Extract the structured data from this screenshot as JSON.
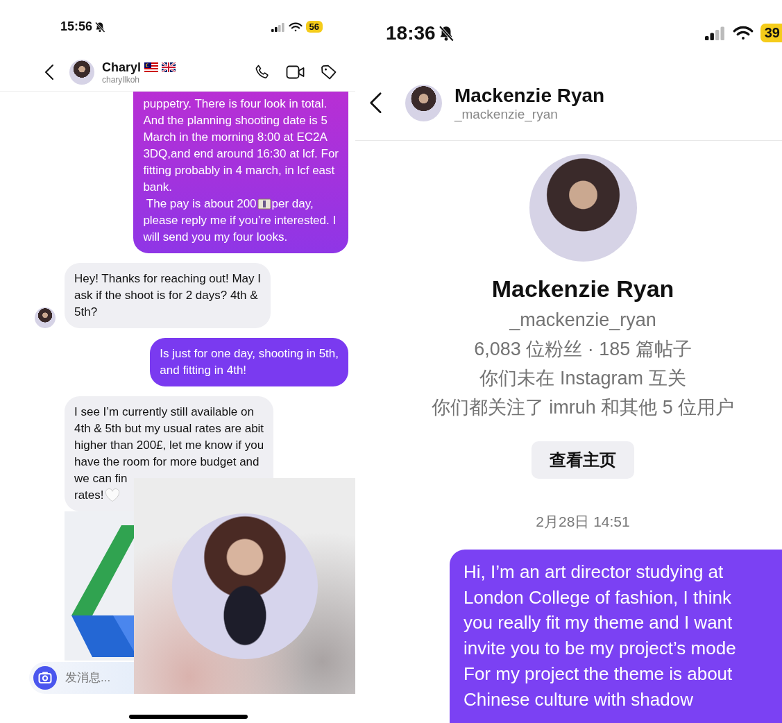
{
  "left_phone": {
    "status_bar": {
      "time": "15:56",
      "battery": "56"
    },
    "header": {
      "name": "Charyl",
      "username": "charyllkoh"
    },
    "messages": [
      {
        "kind": "outgoing",
        "segments": [
          {
            "kind": "text",
            "text": "puppetry. There is four look in total.\nAnd the planning shooting date is 5\nMarch in the morning 8:00 at EC2A\n3DQ,and end around 16:30 at lcf. For\nfitting probably in 4 march, in lcf east\nbank."
          },
          {
            "kind": "line",
            "items": [
              {
                "kind": "text",
                "text": " The pay is about 200"
              },
              {
                "kind": "banknote"
              },
              {
                "kind": "text",
                "text": "per day,"
              }
            ]
          },
          {
            "kind": "text",
            "text": "please reply me if you’re interested. I\nwill send you my four looks."
          }
        ]
      },
      {
        "kind": "incoming",
        "show_avatar": true,
        "segments": [
          {
            "kind": "text",
            "text": "Hey! Thanks for reaching out! May I\nask if the shoot is for 2 days? 4th &\n5th?"
          }
        ]
      },
      {
        "kind": "outgoing",
        "segments": [
          {
            "kind": "text",
            "text": "Is just for one day, shooting in 5th,\nand fitting in 4th!"
          }
        ]
      },
      {
        "kind": "incoming",
        "show_avatar": false,
        "segments": [
          {
            "kind": "text",
            "text": "I see I’m currently still available on\n4th & 5th but my usual rates are abit\nhigher than 200£, let me know if you\nhave the room for more budget and\nwe can fin"
          },
          {
            "kind": "line",
            "items": [
              {
                "kind": "text",
                "text": "rates!"
              },
              {
                "kind": "heart"
              }
            ]
          }
        ]
      },
      {
        "kind": "attachment",
        "show_avatar": false
      }
    ],
    "composer": {
      "placeholder": "发消息..."
    }
  },
  "right_phone": {
    "status_bar": {
      "time": "18:36",
      "battery": "39"
    },
    "header": {
      "name": "Mackenzie Ryan",
      "username": "_mackenzie_ryan"
    },
    "profile": {
      "name": "Mackenzie Ryan",
      "username": "_mackenzie_ryan",
      "stats": "6,083 位粉丝 · 185 篇帖子",
      "mutual_status": "你们未在 Instagram 互关",
      "mutual_follows": "你们都关注了 imruh 和其他 5 位用户",
      "button": "查看主页"
    },
    "timestamp": "2月28日 14:51",
    "messages": [
      {
        "kind": "outgoing",
        "text": "Hi, I’m an art director studying at\nLondon College of fashion, I think\nyou really fit my theme and I want\ninvite you to be my project’s mode\nFor my project the theme is about\nChinese culture with shadow"
      }
    ]
  }
}
